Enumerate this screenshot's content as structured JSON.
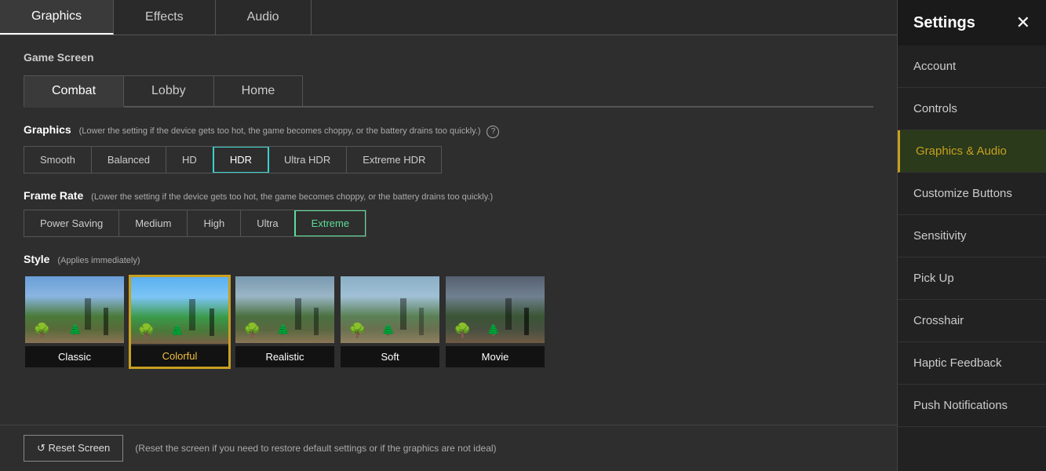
{
  "header": {
    "settings_title": "Settings",
    "close_icon": "✕"
  },
  "top_tabs": [
    {
      "label": "Graphics",
      "active": true
    },
    {
      "label": "Effects",
      "active": false
    },
    {
      "label": "Audio",
      "active": false
    }
  ],
  "game_screen_label": "Game Screen",
  "screen_tabs": [
    {
      "label": "Combat",
      "active": true
    },
    {
      "label": "Lobby",
      "active": false
    },
    {
      "label": "Home",
      "active": false
    }
  ],
  "graphics": {
    "label": "Graphics",
    "sublabel": "(Lower the setting if the device gets too hot, the game becomes choppy, or the battery drains too quickly.)",
    "options": [
      {
        "label": "Smooth",
        "active": false
      },
      {
        "label": "Balanced",
        "active": false
      },
      {
        "label": "HD",
        "active": false
      },
      {
        "label": "HDR",
        "active": true,
        "type": "teal"
      },
      {
        "label": "Ultra HDR",
        "active": false
      },
      {
        "label": "Extreme HDR",
        "active": false
      }
    ]
  },
  "frame_rate": {
    "label": "Frame Rate",
    "sublabel": "(Lower the setting if the device gets too hot, the game becomes choppy, or the battery drains too quickly.)",
    "options": [
      {
        "label": "Power Saving",
        "active": false
      },
      {
        "label": "Medium",
        "active": false
      },
      {
        "label": "High",
        "active": false
      },
      {
        "label": "Ultra",
        "active": false
      },
      {
        "label": "Extreme",
        "active": true,
        "type": "green"
      }
    ]
  },
  "style": {
    "label": "Style",
    "sublabel": "(Applies immediately)",
    "cards": [
      {
        "id": "classic",
        "label": "Classic",
        "selected": false
      },
      {
        "id": "colorful",
        "label": "Colorful",
        "selected": true
      },
      {
        "id": "realistic",
        "label": "Realistic",
        "selected": false
      },
      {
        "id": "soft",
        "label": "Soft",
        "selected": false
      },
      {
        "id": "movie",
        "label": "Movie",
        "selected": false
      }
    ]
  },
  "reset": {
    "button_label": "↺  Reset Screen",
    "note": "(Reset the screen if you need to restore default settings or if the graphics are not ideal)"
  },
  "sidebar": {
    "items": [
      {
        "label": "Account",
        "active": false
      },
      {
        "label": "Controls",
        "active": false
      },
      {
        "label": "Graphics & Audio",
        "active": true
      },
      {
        "label": "Customize Buttons",
        "active": false
      },
      {
        "label": "Sensitivity",
        "active": false
      },
      {
        "label": "Pick Up",
        "active": false
      },
      {
        "label": "Crosshair",
        "active": false
      },
      {
        "label": "Haptic Feedback",
        "active": false
      },
      {
        "label": "Push Notifications",
        "active": false
      }
    ]
  }
}
